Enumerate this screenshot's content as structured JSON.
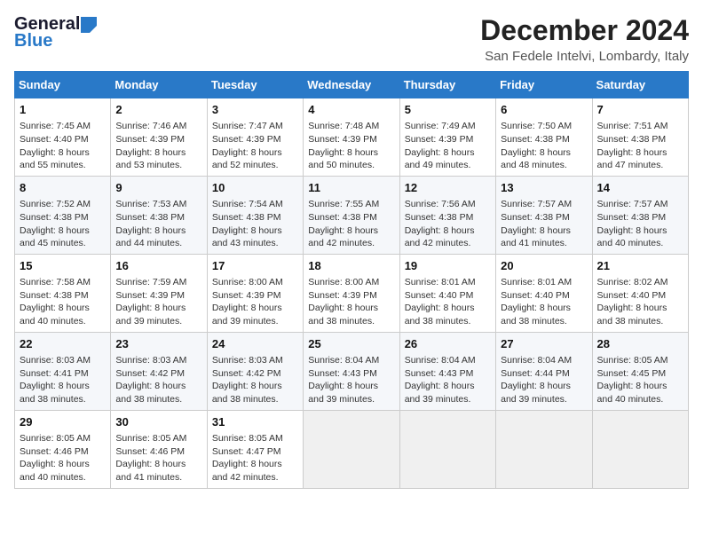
{
  "header": {
    "logo_general": "General",
    "logo_blue": "Blue",
    "month_title": "December 2024",
    "location": "San Fedele Intelvi, Lombardy, Italy"
  },
  "weekdays": [
    "Sunday",
    "Monday",
    "Tuesday",
    "Wednesday",
    "Thursday",
    "Friday",
    "Saturday"
  ],
  "weeks": [
    [
      {
        "day": "1",
        "sunrise": "7:45 AM",
        "sunset": "4:40 PM",
        "daylight": "8 hours and 55 minutes."
      },
      {
        "day": "2",
        "sunrise": "7:46 AM",
        "sunset": "4:39 PM",
        "daylight": "8 hours and 53 minutes."
      },
      {
        "day": "3",
        "sunrise": "7:47 AM",
        "sunset": "4:39 PM",
        "daylight": "8 hours and 52 minutes."
      },
      {
        "day": "4",
        "sunrise": "7:48 AM",
        "sunset": "4:39 PM",
        "daylight": "8 hours and 50 minutes."
      },
      {
        "day": "5",
        "sunrise": "7:49 AM",
        "sunset": "4:39 PM",
        "daylight": "8 hours and 49 minutes."
      },
      {
        "day": "6",
        "sunrise": "7:50 AM",
        "sunset": "4:38 PM",
        "daylight": "8 hours and 48 minutes."
      },
      {
        "day": "7",
        "sunrise": "7:51 AM",
        "sunset": "4:38 PM",
        "daylight": "8 hours and 47 minutes."
      }
    ],
    [
      {
        "day": "8",
        "sunrise": "7:52 AM",
        "sunset": "4:38 PM",
        "daylight": "8 hours and 45 minutes."
      },
      {
        "day": "9",
        "sunrise": "7:53 AM",
        "sunset": "4:38 PM",
        "daylight": "8 hours and 44 minutes."
      },
      {
        "day": "10",
        "sunrise": "7:54 AM",
        "sunset": "4:38 PM",
        "daylight": "8 hours and 43 minutes."
      },
      {
        "day": "11",
        "sunrise": "7:55 AM",
        "sunset": "4:38 PM",
        "daylight": "8 hours and 42 minutes."
      },
      {
        "day": "12",
        "sunrise": "7:56 AM",
        "sunset": "4:38 PM",
        "daylight": "8 hours and 42 minutes."
      },
      {
        "day": "13",
        "sunrise": "7:57 AM",
        "sunset": "4:38 PM",
        "daylight": "8 hours and 41 minutes."
      },
      {
        "day": "14",
        "sunrise": "7:57 AM",
        "sunset": "4:38 PM",
        "daylight": "8 hours and 40 minutes."
      }
    ],
    [
      {
        "day": "15",
        "sunrise": "7:58 AM",
        "sunset": "4:38 PM",
        "daylight": "8 hours and 40 minutes."
      },
      {
        "day": "16",
        "sunrise": "7:59 AM",
        "sunset": "4:39 PM",
        "daylight": "8 hours and 39 minutes."
      },
      {
        "day": "17",
        "sunrise": "8:00 AM",
        "sunset": "4:39 PM",
        "daylight": "8 hours and 39 minutes."
      },
      {
        "day": "18",
        "sunrise": "8:00 AM",
        "sunset": "4:39 PM",
        "daylight": "8 hours and 38 minutes."
      },
      {
        "day": "19",
        "sunrise": "8:01 AM",
        "sunset": "4:40 PM",
        "daylight": "8 hours and 38 minutes."
      },
      {
        "day": "20",
        "sunrise": "8:01 AM",
        "sunset": "4:40 PM",
        "daylight": "8 hours and 38 minutes."
      },
      {
        "day": "21",
        "sunrise": "8:02 AM",
        "sunset": "4:40 PM",
        "daylight": "8 hours and 38 minutes."
      }
    ],
    [
      {
        "day": "22",
        "sunrise": "8:03 AM",
        "sunset": "4:41 PM",
        "daylight": "8 hours and 38 minutes."
      },
      {
        "day": "23",
        "sunrise": "8:03 AM",
        "sunset": "4:42 PM",
        "daylight": "8 hours and 38 minutes."
      },
      {
        "day": "24",
        "sunrise": "8:03 AM",
        "sunset": "4:42 PM",
        "daylight": "8 hours and 38 minutes."
      },
      {
        "day": "25",
        "sunrise": "8:04 AM",
        "sunset": "4:43 PM",
        "daylight": "8 hours and 39 minutes."
      },
      {
        "day": "26",
        "sunrise": "8:04 AM",
        "sunset": "4:43 PM",
        "daylight": "8 hours and 39 minutes."
      },
      {
        "day": "27",
        "sunrise": "8:04 AM",
        "sunset": "4:44 PM",
        "daylight": "8 hours and 39 minutes."
      },
      {
        "day": "28",
        "sunrise": "8:05 AM",
        "sunset": "4:45 PM",
        "daylight": "8 hours and 40 minutes."
      }
    ],
    [
      {
        "day": "29",
        "sunrise": "8:05 AM",
        "sunset": "4:46 PM",
        "daylight": "8 hours and 40 minutes."
      },
      {
        "day": "30",
        "sunrise": "8:05 AM",
        "sunset": "4:46 PM",
        "daylight": "8 hours and 41 minutes."
      },
      {
        "day": "31",
        "sunrise": "8:05 AM",
        "sunset": "4:47 PM",
        "daylight": "8 hours and 42 minutes."
      },
      null,
      null,
      null,
      null
    ]
  ],
  "labels": {
    "sunrise": "Sunrise:",
    "sunset": "Sunset:",
    "daylight": "Daylight:"
  }
}
